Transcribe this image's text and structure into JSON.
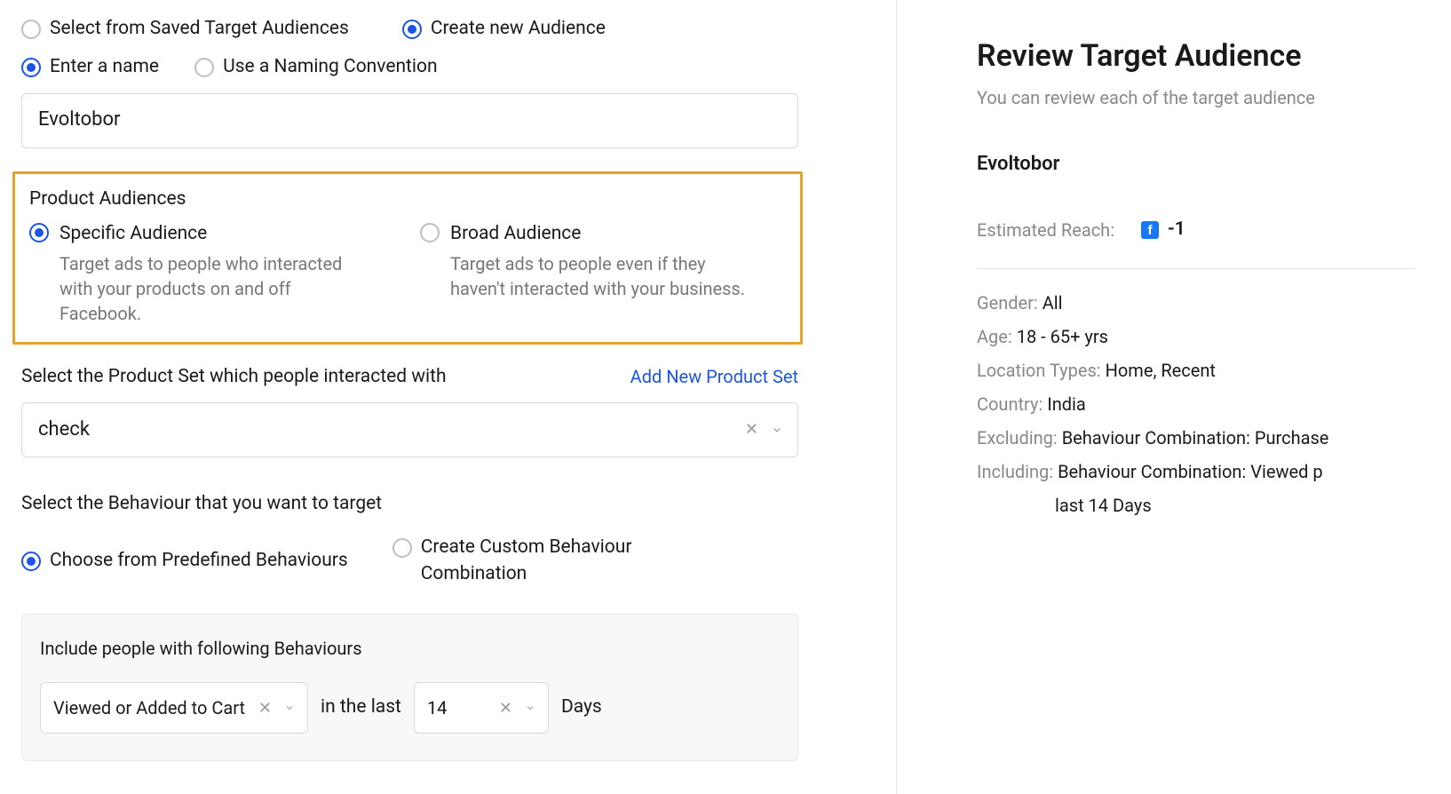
{
  "audienceSource": {
    "saved": "Select from Saved Target Audiences",
    "create": "Create new Audience"
  },
  "nameMode": {
    "enter": "Enter a name",
    "convention": "Use a Naming Convention"
  },
  "nameValue": "Evoltobor",
  "productAudiences": {
    "heading": "Product Audiences",
    "specific": {
      "title": "Specific Audience",
      "desc": "Target ads to people who interacted with your products on and off Facebook."
    },
    "broad": {
      "title": "Broad Audience",
      "desc": "Target ads to people even if they haven't interacted with your business."
    }
  },
  "productSet": {
    "label": "Select the Product Set which people interacted with",
    "link": "Add New Product Set",
    "value": "check"
  },
  "behaviour": {
    "label": "Select the Behaviour that you want to target",
    "predefined": "Choose from Predefined Behaviours",
    "custom": "Create Custom Behaviour Combination"
  },
  "include": {
    "title": "Include people with following Behaviours",
    "behaviourValue": "Viewed or Added to Cart",
    "since": "in the last",
    "daysValue": "14",
    "daysSuffix": "Days"
  },
  "review": {
    "title": "Review Target Audience",
    "subtitle": "You can review each of the target audience",
    "name": "Evoltobor",
    "reachLabel": "Estimated Reach:",
    "reachValue": "-1",
    "gender": {
      "k": "Gender:",
      "v": "All"
    },
    "age": {
      "k": "Age:",
      "v": "18 - 65+ yrs"
    },
    "locationTypes": {
      "k": "Location Types:",
      "v": "Home, Recent"
    },
    "country": {
      "k": "Country:",
      "v": "India"
    },
    "excluding": {
      "k": "Excluding:",
      "v": "Behaviour Combination: Purchase"
    },
    "including": {
      "k": "Including:",
      "v": "Behaviour Combination: Viewed p"
    },
    "includingLine2": "last 14 Days"
  }
}
